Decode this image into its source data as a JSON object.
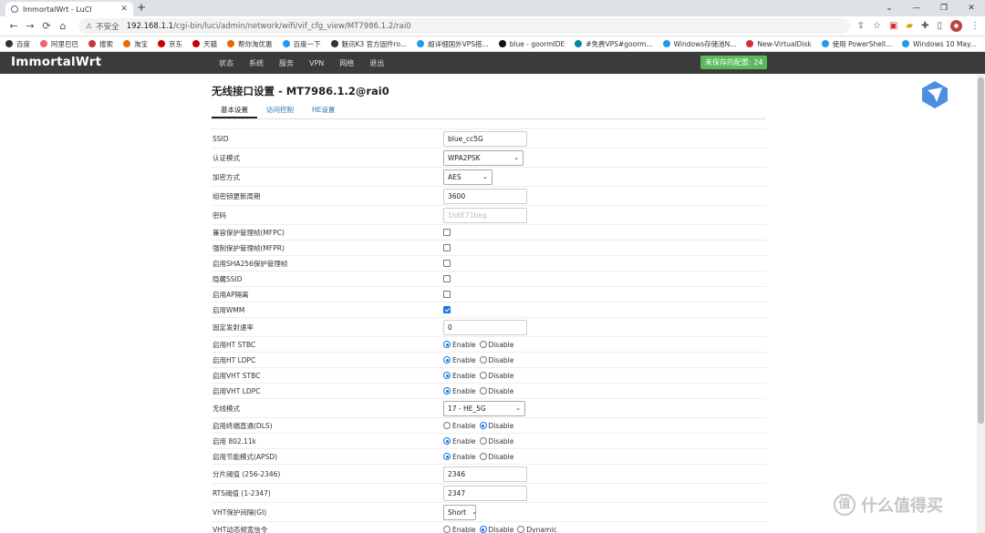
{
  "browser": {
    "tab_title": "ImmortalWrt - LuCI",
    "security_label": "不安全",
    "url_host": "192.168.1.1",
    "url_path": "/cgi-bin/luci/admin/network/wifi/vif_cfg_view/MT7986.1.2/rai0",
    "bookmarks": [
      "百度",
      "阿里巴巴",
      "搜索",
      "淘宝",
      "京东",
      "天猫",
      "帮你淘优惠",
      "百度一下",
      "魅讯K3 官方固件ro...",
      "超详细国外VPS搭...",
      "blue - goormIDE",
      "#免费VPS#goorm...",
      "Windows存储池N...",
      "New-VirtualDisk",
      "使用 PowerShell...",
      "Windows 10 May..."
    ]
  },
  "luci": {
    "brand": "ImmortalWrt",
    "menu": [
      "状态",
      "系统",
      "服务",
      "VPN",
      "网络",
      "退出"
    ],
    "unsaved": "未保存的配置: 24",
    "page_title": "无线接口设置 - MT7986.1.2@rai0",
    "tabs": [
      "基本设置",
      "访问控制",
      "HE设置"
    ]
  },
  "form": [
    {
      "label": "SSID",
      "type": "text",
      "value": "blue_cc5G"
    },
    {
      "label": "认证模式",
      "type": "select",
      "value": "WPA2PSK"
    },
    {
      "label": "加密方式",
      "type": "select",
      "value": "AES"
    },
    {
      "label": "组密钥更新周期",
      "type": "text",
      "value": "3600"
    },
    {
      "label": "密码",
      "type": "password",
      "value": "1h6E71beg"
    },
    {
      "label": "兼容保护管理帧(MFPC)",
      "type": "checkbox",
      "checked": false
    },
    {
      "label": "强制保护管理帧(MFPR)",
      "type": "checkbox",
      "checked": false
    },
    {
      "label": "启用SHA256保护管理帧",
      "type": "checkbox",
      "checked": false
    },
    {
      "label": "隐藏SSID",
      "type": "checkbox",
      "checked": false
    },
    {
      "label": "启用AP隔离",
      "type": "checkbox",
      "checked": false
    },
    {
      "label": "启用WMM",
      "type": "checkbox",
      "checked": true
    },
    {
      "label": "固定发射速率",
      "type": "text",
      "value": "0"
    },
    {
      "label": "启用HT STBC",
      "type": "radio",
      "options": [
        "Enable",
        "Disable"
      ],
      "selected": 0
    },
    {
      "label": "启用HT LDPC",
      "type": "radio",
      "options": [
        "Enable",
        "Disable"
      ],
      "selected": 0
    },
    {
      "label": "启用VHT STBC",
      "type": "radio",
      "options": [
        "Enable",
        "Disable"
      ],
      "selected": 0
    },
    {
      "label": "启用VHT LDPC",
      "type": "radio",
      "options": [
        "Enable",
        "Disable"
      ],
      "selected": 0
    },
    {
      "label": "无线模式",
      "type": "select",
      "value": "17 - HE_5G"
    },
    {
      "label": "启用终端直通(DLS)",
      "type": "radio",
      "options": [
        "Enable",
        "Disable"
      ],
      "selected": 1
    },
    {
      "label": "启用 802.11k",
      "type": "radio",
      "options": [
        "Enable",
        "Disable"
      ],
      "selected": 0
    },
    {
      "label": "启用节能模式(APSD)",
      "type": "radio",
      "options": [
        "Enable",
        "Disable"
      ],
      "selected": 0
    },
    {
      "label": "分片阈值 (256-2346)",
      "type": "text",
      "value": "2346"
    },
    {
      "label": "RTS阈值 (1-2347)",
      "type": "text",
      "value": "2347"
    },
    {
      "label": "VHT保护间隔(GI)",
      "type": "select",
      "value": "Short"
    },
    {
      "label": "VHT动态频宽信令",
      "type": "radio",
      "options": [
        "Enable",
        "Disable",
        "Dynamic"
      ],
      "selected": 1
    }
  ],
  "watermark": "什么值得买",
  "colors": {
    "header_bg": "#3b3b3b",
    "unsaved_bg": "#5cb85c",
    "accent": "#1a73e8"
  }
}
